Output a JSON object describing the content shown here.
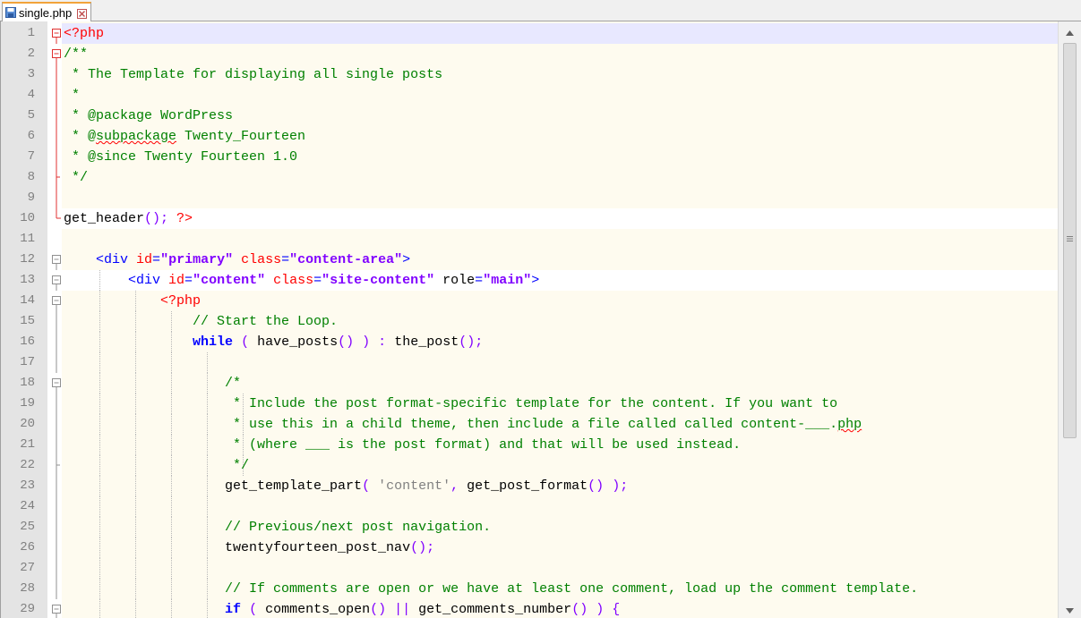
{
  "tab": {
    "filename": "single.php",
    "icon": "save-disk-icon",
    "close_icon": "close-icon"
  },
  "colors": {
    "php_tag": "#ff0000",
    "comment": "#008000",
    "html_tag": "#0000ff",
    "string": "#8000ff",
    "keyword": "#0000ff",
    "current_line": "#e8e8ff",
    "editor_bg": "#fefbef"
  },
  "lines": [
    {
      "n": "1",
      "bg": "current",
      "fold": "box-minus-red",
      "guides": [],
      "tokens": [
        {
          "t": "<?php",
          "c": "php"
        }
      ]
    },
    {
      "n": "2",
      "bg": "",
      "fold": "box-minus-red",
      "guides": [],
      "tokens": [
        {
          "t": "/**",
          "c": "comment"
        }
      ]
    },
    {
      "n": "3",
      "bg": "",
      "fold": "line-red",
      "guides": [],
      "tokens": [
        {
          "t": " * The Template for displaying all single posts",
          "c": "comment"
        }
      ]
    },
    {
      "n": "4",
      "bg": "",
      "fold": "line-red",
      "guides": [],
      "tokens": [
        {
          "t": " *",
          "c": "comment"
        }
      ]
    },
    {
      "n": "5",
      "bg": "",
      "fold": "line-red",
      "guides": [],
      "tokens": [
        {
          "t": " * @package WordPress",
          "c": "comment"
        }
      ]
    },
    {
      "n": "6",
      "bg": "",
      "fold": "line-red",
      "guides": [],
      "tokens": [
        {
          "t": " * @",
          "c": "comment"
        },
        {
          "t": "subpackage",
          "c": "comment squiggle"
        },
        {
          "t": " Twenty_Fourteen",
          "c": "comment"
        }
      ]
    },
    {
      "n": "7",
      "bg": "",
      "fold": "line-red",
      "guides": [],
      "tokens": [
        {
          "t": " * @since Twenty Fourteen 1.0",
          "c": "comment"
        }
      ]
    },
    {
      "n": "8",
      "bg": "",
      "fold": "end-red",
      "guides": [],
      "tokens": [
        {
          "t": " */",
          "c": "comment"
        }
      ]
    },
    {
      "n": "9",
      "bg": "",
      "fold": "line-red",
      "guides": [],
      "tokens": []
    },
    {
      "n": "10",
      "bg": "white",
      "fold": "corner-red",
      "guides": [],
      "tokens": [
        {
          "t": "get_header",
          "c": "plain"
        },
        {
          "t": "();",
          "c": "op"
        },
        {
          "t": " ",
          "c": "plain"
        },
        {
          "t": "?>",
          "c": "php"
        }
      ]
    },
    {
      "n": "11",
      "bg": "",
      "fold": "",
      "guides": [],
      "tokens": []
    },
    {
      "n": "12",
      "bg": "",
      "fold": "box-minus",
      "guides": [],
      "tokens": [
        {
          "t": "    ",
          "c": "plain"
        },
        {
          "t": "<div ",
          "c": "tag"
        },
        {
          "t": "id",
          "c": "attr"
        },
        {
          "t": "=",
          "c": "tag"
        },
        {
          "t": "\"primary\"",
          "c": "str"
        },
        {
          "t": " ",
          "c": "tag"
        },
        {
          "t": "class",
          "c": "attr"
        },
        {
          "t": "=",
          "c": "tag"
        },
        {
          "t": "\"content-area\"",
          "c": "str"
        },
        {
          "t": ">",
          "c": "tag"
        }
      ]
    },
    {
      "n": "13",
      "bg": "white",
      "fold": "box-minus",
      "guides": [
        4
      ],
      "tokens": [
        {
          "t": "        ",
          "c": "plain"
        },
        {
          "t": "<div ",
          "c": "tag"
        },
        {
          "t": "id",
          "c": "attr"
        },
        {
          "t": "=",
          "c": "tag"
        },
        {
          "t": "\"content\"",
          "c": "str"
        },
        {
          "t": " ",
          "c": "tag"
        },
        {
          "t": "class",
          "c": "attr"
        },
        {
          "t": "=",
          "c": "tag"
        },
        {
          "t": "\"site-content\"",
          "c": "str"
        },
        {
          "t": " role",
          "c": "plain"
        },
        {
          "t": "=",
          "c": "tag"
        },
        {
          "t": "\"main\"",
          "c": "str"
        },
        {
          "t": ">",
          "c": "tag"
        }
      ]
    },
    {
      "n": "14",
      "bg": "",
      "fold": "box-minus",
      "guides": [
        4,
        8
      ],
      "tokens": [
        {
          "t": "            ",
          "c": "plain"
        },
        {
          "t": "<?php",
          "c": "php"
        }
      ]
    },
    {
      "n": "15",
      "bg": "",
      "fold": "line",
      "guides": [
        4,
        8,
        12
      ],
      "tokens": [
        {
          "t": "                ",
          "c": "plain"
        },
        {
          "t": "// Start the Loop.",
          "c": "comment"
        }
      ]
    },
    {
      "n": "16",
      "bg": "",
      "fold": "line",
      "guides": [
        4,
        8,
        12
      ],
      "tokens": [
        {
          "t": "                ",
          "c": "plain"
        },
        {
          "t": "while",
          "c": "kw"
        },
        {
          "t": " ",
          "c": "plain"
        },
        {
          "t": "(",
          "c": "op"
        },
        {
          "t": " have_posts",
          "c": "plain"
        },
        {
          "t": "()",
          "c": "op"
        },
        {
          "t": " ",
          "c": "plain"
        },
        {
          "t": ")",
          "c": "op"
        },
        {
          "t": " ",
          "c": "plain"
        },
        {
          "t": ":",
          "c": "op"
        },
        {
          "t": " the_post",
          "c": "plain"
        },
        {
          "t": "();",
          "c": "op"
        }
      ]
    },
    {
      "n": "17",
      "bg": "",
      "fold": "line",
      "guides": [
        4,
        8,
        12,
        16
      ],
      "tokens": []
    },
    {
      "n": "18",
      "bg": "",
      "fold": "box-minus",
      "guides": [
        4,
        8,
        12,
        16
      ],
      "tokens": [
        {
          "t": "                    ",
          "c": "plain"
        },
        {
          "t": "/*",
          "c": "comment"
        }
      ]
    },
    {
      "n": "19",
      "bg": "",
      "fold": "line",
      "guides": [
        4,
        8,
        12,
        16,
        20
      ],
      "tokens": [
        {
          "t": "                    ",
          "c": "plain"
        },
        {
          "t": " * Include the post format-specific template for the content. If you want to",
          "c": "comment"
        }
      ]
    },
    {
      "n": "20",
      "bg": "",
      "fold": "line",
      "guides": [
        4,
        8,
        12,
        16,
        20
      ],
      "tokens": [
        {
          "t": "                    ",
          "c": "plain"
        },
        {
          "t": " * use this in a child theme, then include a file called called content-___.",
          "c": "comment"
        },
        {
          "t": "php",
          "c": "comment squiggle"
        }
      ]
    },
    {
      "n": "21",
      "bg": "",
      "fold": "line",
      "guides": [
        4,
        8,
        12,
        16,
        20
      ],
      "tokens": [
        {
          "t": "                    ",
          "c": "plain"
        },
        {
          "t": " * (where ___ is the post format) and that will be used instead.",
          "c": "comment"
        }
      ]
    },
    {
      "n": "22",
      "bg": "",
      "fold": "end",
      "guides": [
        4,
        8,
        12,
        16,
        20
      ],
      "tokens": [
        {
          "t": "                    ",
          "c": "plain"
        },
        {
          "t": " */",
          "c": "comment"
        }
      ]
    },
    {
      "n": "23",
      "bg": "",
      "fold": "line",
      "guides": [
        4,
        8,
        12,
        16
      ],
      "tokens": [
        {
          "t": "                    ",
          "c": "plain"
        },
        {
          "t": "get_template_part",
          "c": "plain"
        },
        {
          "t": "(",
          "c": "op"
        },
        {
          "t": " ",
          "c": "plain"
        },
        {
          "t": "'content'",
          "c": "sq"
        },
        {
          "t": ",",
          "c": "op"
        },
        {
          "t": " get_post_format",
          "c": "plain"
        },
        {
          "t": "()",
          "c": "op"
        },
        {
          "t": " ",
          "c": "plain"
        },
        {
          "t": ");",
          "c": "op"
        }
      ]
    },
    {
      "n": "24",
      "bg": "",
      "fold": "line",
      "guides": [
        4,
        8,
        12,
        16
      ],
      "tokens": []
    },
    {
      "n": "25",
      "bg": "",
      "fold": "line",
      "guides": [
        4,
        8,
        12,
        16
      ],
      "tokens": [
        {
          "t": "                    ",
          "c": "plain"
        },
        {
          "t": "// Previous/next post navigation.",
          "c": "comment"
        }
      ]
    },
    {
      "n": "26",
      "bg": "",
      "fold": "line",
      "guides": [
        4,
        8,
        12,
        16
      ],
      "tokens": [
        {
          "t": "                    ",
          "c": "plain"
        },
        {
          "t": "twentyfourteen_post_nav",
          "c": "plain"
        },
        {
          "t": "();",
          "c": "op"
        }
      ]
    },
    {
      "n": "27",
      "bg": "",
      "fold": "line",
      "guides": [
        4,
        8,
        12,
        16
      ],
      "tokens": []
    },
    {
      "n": "28",
      "bg": "",
      "fold": "line",
      "guides": [
        4,
        8,
        12,
        16
      ],
      "tokens": [
        {
          "t": "                    ",
          "c": "plain"
        },
        {
          "t": "// If comments are open or we have at least one comment, load up the comment template.",
          "c": "comment"
        }
      ]
    },
    {
      "n": "29",
      "bg": "",
      "fold": "box-minus",
      "guides": [
        4,
        8,
        12,
        16
      ],
      "tokens": [
        {
          "t": "                    ",
          "c": "plain"
        },
        {
          "t": "if",
          "c": "kw"
        },
        {
          "t": " ",
          "c": "plain"
        },
        {
          "t": "(",
          "c": "op"
        },
        {
          "t": " comments_open",
          "c": "plain"
        },
        {
          "t": "()",
          "c": "op"
        },
        {
          "t": " ",
          "c": "plain"
        },
        {
          "t": "||",
          "c": "op"
        },
        {
          "t": " get_comments_number",
          "c": "plain"
        },
        {
          "t": "()",
          "c": "op"
        },
        {
          "t": " ",
          "c": "plain"
        },
        {
          "t": ")",
          "c": "op"
        },
        {
          "t": " ",
          "c": "plain"
        },
        {
          "t": "{",
          "c": "op"
        }
      ]
    }
  ]
}
